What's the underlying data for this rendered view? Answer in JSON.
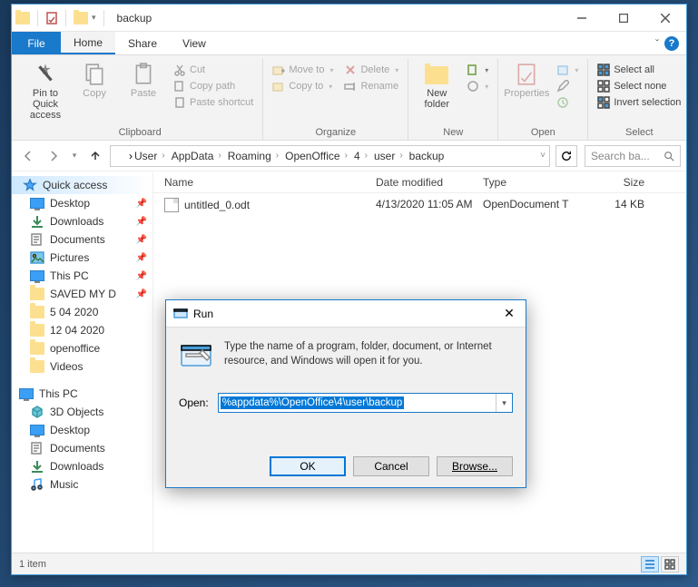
{
  "titlebar": {
    "title": "backup"
  },
  "menubar": {
    "file": "File",
    "tabs": [
      "Home",
      "Share",
      "View"
    ],
    "active": "Home"
  },
  "ribbon": {
    "clipboard": {
      "label": "Clipboard",
      "pin_to": "Pin to Quick access",
      "copy": "Copy",
      "paste": "Paste",
      "cut": "Cut",
      "copy_path": "Copy path",
      "paste_shortcut": "Paste shortcut"
    },
    "organize": {
      "label": "Organize",
      "move_to": "Move to",
      "copy_to": "Copy to",
      "delete": "Delete",
      "rename": "Rename"
    },
    "new": {
      "label": "New",
      "new_folder": "New folder"
    },
    "open": {
      "label": "Open",
      "properties": "Properties"
    },
    "select": {
      "label": "Select",
      "select_all": "Select all",
      "select_none": "Select none",
      "invert": "Invert selection"
    }
  },
  "breadcrumb": [
    "User",
    "AppData",
    "Roaming",
    "OpenOffice",
    "4",
    "user",
    "backup"
  ],
  "search": {
    "placeholder": "Search ba..."
  },
  "columns": {
    "name": "Name",
    "date": "Date modified",
    "type": "Type",
    "size": "Size"
  },
  "files": [
    {
      "name": "untitled_0.odt",
      "date": "4/13/2020 11:05 AM",
      "type": "OpenDocument T",
      "size": "14 KB"
    }
  ],
  "sidebar": {
    "quick_access": "Quick access",
    "qa_items": [
      "Desktop",
      "Downloads",
      "Documents",
      "Pictures",
      "This PC",
      "SAVED MY D",
      "5 04 2020",
      "12 04 2020",
      "openoffice",
      "Videos"
    ],
    "this_pc": "This PC",
    "pc_items": [
      "3D Objects",
      "Desktop",
      "Documents",
      "Downloads",
      "Music"
    ]
  },
  "status": {
    "count": "1 item"
  },
  "run": {
    "title": "Run",
    "text": "Type the name of a program, folder, document, or Internet resource, and Windows will open it for you.",
    "open_label": "Open:",
    "value": "%appdata%\\OpenOffice\\4\\user\\backup",
    "ok": "OK",
    "cancel": "Cancel",
    "browse": "Browse..."
  }
}
